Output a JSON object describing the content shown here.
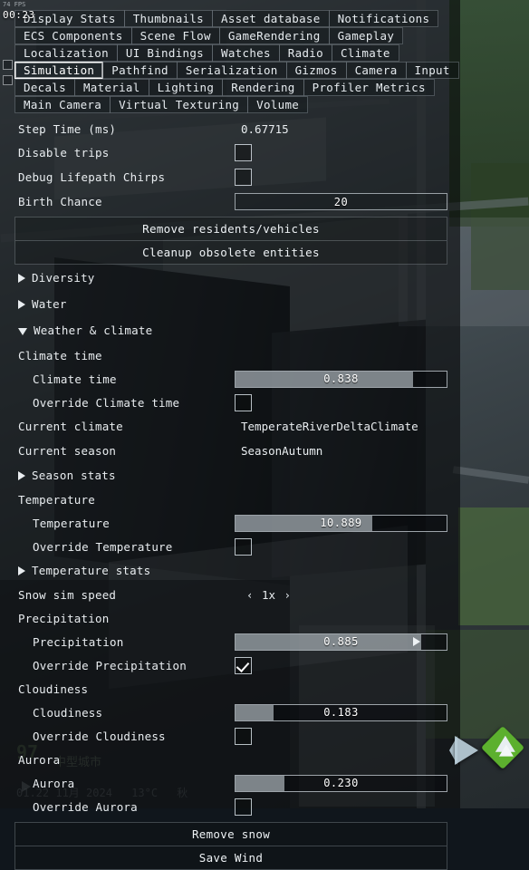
{
  "hud": {
    "fps_text": "74 FPS",
    "clock": "00:23",
    "city_number": "97",
    "city_name": "中型城市",
    "date": "01.22  11月 2024",
    "temperature": "13°C",
    "season_glyph": "秋",
    "play_icon": "play-icon",
    "terrain_icon": "terrain-map-icon"
  },
  "tabs": {
    "row1": [
      {
        "label": "Display Stats",
        "selected": false
      },
      {
        "label": "Thumbnails",
        "selected": false
      },
      {
        "label": "Asset database",
        "selected": false
      },
      {
        "label": "Notifications",
        "selected": false
      }
    ],
    "row2": [
      {
        "label": "ECS Components",
        "selected": false
      },
      {
        "label": "Scene Flow",
        "selected": false
      },
      {
        "label": "GameRendering",
        "selected": false
      },
      {
        "label": "Gameplay",
        "selected": false
      }
    ],
    "row3": [
      {
        "label": "Localization",
        "selected": false
      },
      {
        "label": "UI Bindings",
        "selected": false
      },
      {
        "label": "Watches",
        "selected": false
      },
      {
        "label": "Radio",
        "selected": false
      },
      {
        "label": "Climate",
        "selected": false
      }
    ],
    "row4": [
      {
        "label": "Simulation",
        "selected": true
      },
      {
        "label": "Pathfind",
        "selected": false
      },
      {
        "label": "Serialization",
        "selected": false
      },
      {
        "label": "Gizmos",
        "selected": false
      },
      {
        "label": "Camera",
        "selected": false
      },
      {
        "label": "Input",
        "selected": false
      }
    ],
    "row5": [
      {
        "label": "Decals",
        "selected": false
      },
      {
        "label": "Material",
        "selected": false
      },
      {
        "label": "Lighting",
        "selected": false
      },
      {
        "label": "Rendering",
        "selected": false
      },
      {
        "label": "Profiler Metrics",
        "selected": false
      }
    ],
    "row6": [
      {
        "label": "Main Camera",
        "selected": false
      },
      {
        "label": "Virtual Texturing",
        "selected": false
      },
      {
        "label": "Volume",
        "selected": false
      }
    ]
  },
  "fields": {
    "step_time": {
      "label": "Step Time (ms)",
      "value": "0.67715"
    },
    "disable_trips": {
      "label": "Disable trips",
      "checked": false
    },
    "debug_lifepath": {
      "label": "Debug Lifepath Chirps",
      "checked": false
    },
    "birth_chance": {
      "label": "Birth Chance",
      "value": "20"
    },
    "remove_residents": {
      "label": "Remove residents/vehicles"
    },
    "cleanup_entities": {
      "label": "Cleanup obsolete entities"
    },
    "diversity": {
      "label": "Diversity",
      "expanded": false
    },
    "water": {
      "label": "Water",
      "expanded": false
    },
    "weather_climate": {
      "label": "Weather & climate",
      "expanded": true
    },
    "climate_time_group": {
      "label": "Climate time"
    },
    "climate_time": {
      "label": "Climate time",
      "value": "0.838",
      "fill_percent": 84
    },
    "override_climate_time": {
      "label": "Override Climate time",
      "checked": false
    },
    "current_climate": {
      "label": "Current climate",
      "value": "TemperateRiverDeltaClimate"
    },
    "current_season": {
      "label": "Current season",
      "value": "SeasonAutumn"
    },
    "season_stats": {
      "label": "Season stats",
      "expanded": false
    },
    "temperature_group": {
      "label": "Temperature"
    },
    "temperature": {
      "label": "Temperature",
      "value": "10.889",
      "fill_percent": 65
    },
    "override_temperature": {
      "label": "Override Temperature",
      "checked": false
    },
    "temperature_stats": {
      "label": "Temperature stats",
      "expanded": false
    },
    "snow_sim_speed": {
      "label": "Snow sim speed",
      "value": "1x",
      "prev": "‹",
      "next": "›"
    },
    "precipitation_group": {
      "label": "Precipitation"
    },
    "precipitation": {
      "label": "Precipitation",
      "value": "0.885",
      "fill_percent": 88
    },
    "override_precipitation": {
      "label": "Override Precipitation",
      "checked": true
    },
    "cloudiness_group": {
      "label": "Cloudiness"
    },
    "cloudiness": {
      "label": "Cloudiness",
      "value": "0.183",
      "fill_percent": 18
    },
    "override_cloudiness": {
      "label": "Override Cloudiness",
      "checked": false
    },
    "aurora_group": {
      "label": "Aurora"
    },
    "aurora": {
      "label": "Aurora",
      "value": "0.230",
      "fill_percent": 23
    },
    "override_aurora": {
      "label": "Override Aurora",
      "checked": false
    },
    "remove_snow": {
      "label": "Remove snow"
    },
    "save_wind": {
      "label": "Save Wind"
    }
  },
  "colors": {
    "panel_bg": "#0a0c0f",
    "text": "#e9edf0",
    "slider_fill": "#c4cdd4",
    "accent_selected": "#ffffff",
    "terrain_green": "#5cb02e"
  }
}
